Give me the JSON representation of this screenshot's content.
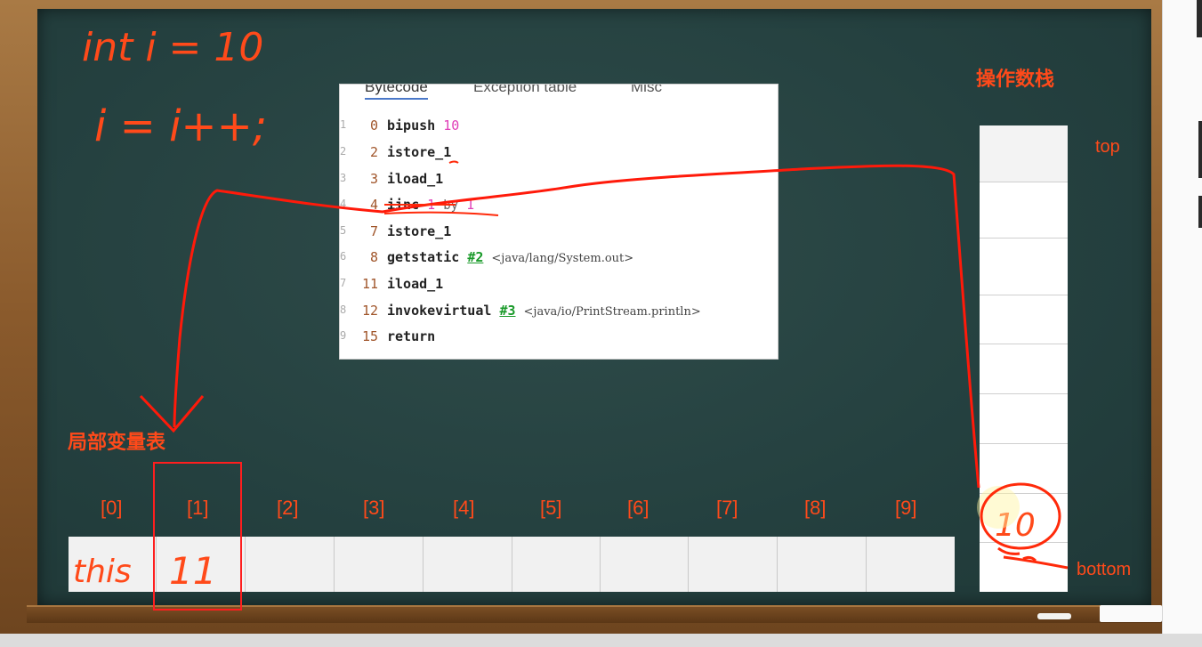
{
  "tabs": [
    {
      "label": "Bytecode",
      "active": true
    },
    {
      "label": "Exception table",
      "active": false
    },
    {
      "label": "Misc",
      "active": false
    }
  ],
  "bytecode": [
    {
      "row": "1",
      "pc": "0",
      "op": "bipush",
      "arg": "10"
    },
    {
      "row": "2",
      "pc": "2",
      "op": "istore_1"
    },
    {
      "row": "3",
      "pc": "3",
      "op": "iload_1"
    },
    {
      "row": "4",
      "pc": "4",
      "op": "iinc",
      "arg": "1",
      "kw": "by",
      "arg2": "1"
    },
    {
      "row": "5",
      "pc": "7",
      "op": "istore_1"
    },
    {
      "row": "6",
      "pc": "8",
      "op": "getstatic",
      "ref": "#2",
      "comment": "<java/lang/System.out>"
    },
    {
      "row": "7",
      "pc": "11",
      "op": "iload_1"
    },
    {
      "row": "8",
      "pc": "12",
      "op": "invokevirtual",
      "ref": "#3",
      "comment": "<java/io/PrintStream.println>"
    },
    {
      "row": "9",
      "pc": "15",
      "op": "return"
    }
  ],
  "labels": {
    "operand_stack": "操作数栈",
    "local_var_table": "局部变量表",
    "top": "top",
    "bottom": "bottom"
  },
  "lvt_indices": [
    "[0]",
    "[1]",
    "[2]",
    "[3]",
    "[4]",
    "[5]",
    "[6]",
    "[7]",
    "[8]",
    "[9]"
  ],
  "handwriting": {
    "line1": "int i = 10",
    "line2": "i = i++;",
    "lvt_slot0": "this",
    "lvt_slot1": "11",
    "stack_value": "10"
  },
  "colors": {
    "chalk_red": "#ff4a1a",
    "board": "#24403f",
    "frame": "#8a5a2c",
    "highlight": "#ff1e1e",
    "ref_green": "#1a9a2a",
    "arg_magenta": "#e040b8"
  }
}
